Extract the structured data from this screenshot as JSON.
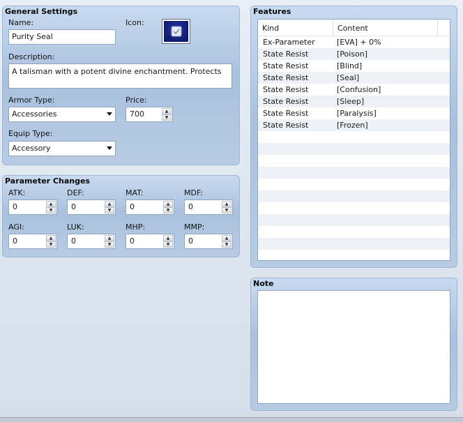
{
  "general": {
    "title": "General Settings",
    "name_label": "Name:",
    "name_value": "Purity Seal",
    "icon_label": "Icon:",
    "description_label": "Description:",
    "description_value": "A talisman with a potent divine enchantment. Protects",
    "armor_type_label": "Armor Type:",
    "armor_type_value": "Accessories",
    "price_label": "Price:",
    "price_value": "700",
    "equip_type_label": "Equip Type:",
    "equip_type_value": "Accessory"
  },
  "params": {
    "title": "Parameter Changes",
    "items": [
      {
        "label": "ATK:",
        "value": "0"
      },
      {
        "label": "DEF:",
        "value": "0"
      },
      {
        "label": "MAT:",
        "value": "0"
      },
      {
        "label": "MDF:",
        "value": "0"
      },
      {
        "label": "AGI:",
        "value": "0"
      },
      {
        "label": "LUK:",
        "value": "0"
      },
      {
        "label": "MHP:",
        "value": "0"
      },
      {
        "label": "MMP:",
        "value": "0"
      }
    ]
  },
  "features": {
    "title": "Features",
    "col_kind": "Kind",
    "col_content": "Content",
    "rows": [
      {
        "kind": "Ex-Parameter",
        "content": "[EVA] + 0%"
      },
      {
        "kind": "State Resist",
        "content": "[Poison]"
      },
      {
        "kind": "State Resist",
        "content": "[Blind]"
      },
      {
        "kind": "State Resist",
        "content": "[Seal]"
      },
      {
        "kind": "State Resist",
        "content": "[Confusion]"
      },
      {
        "kind": "State Resist",
        "content": "[Sleep]"
      },
      {
        "kind": "State Resist",
        "content": "[Paralysis]"
      },
      {
        "kind": "State Resist",
        "content": "[Frozen]"
      }
    ]
  },
  "note": {
    "title": "Note",
    "value": ""
  }
}
